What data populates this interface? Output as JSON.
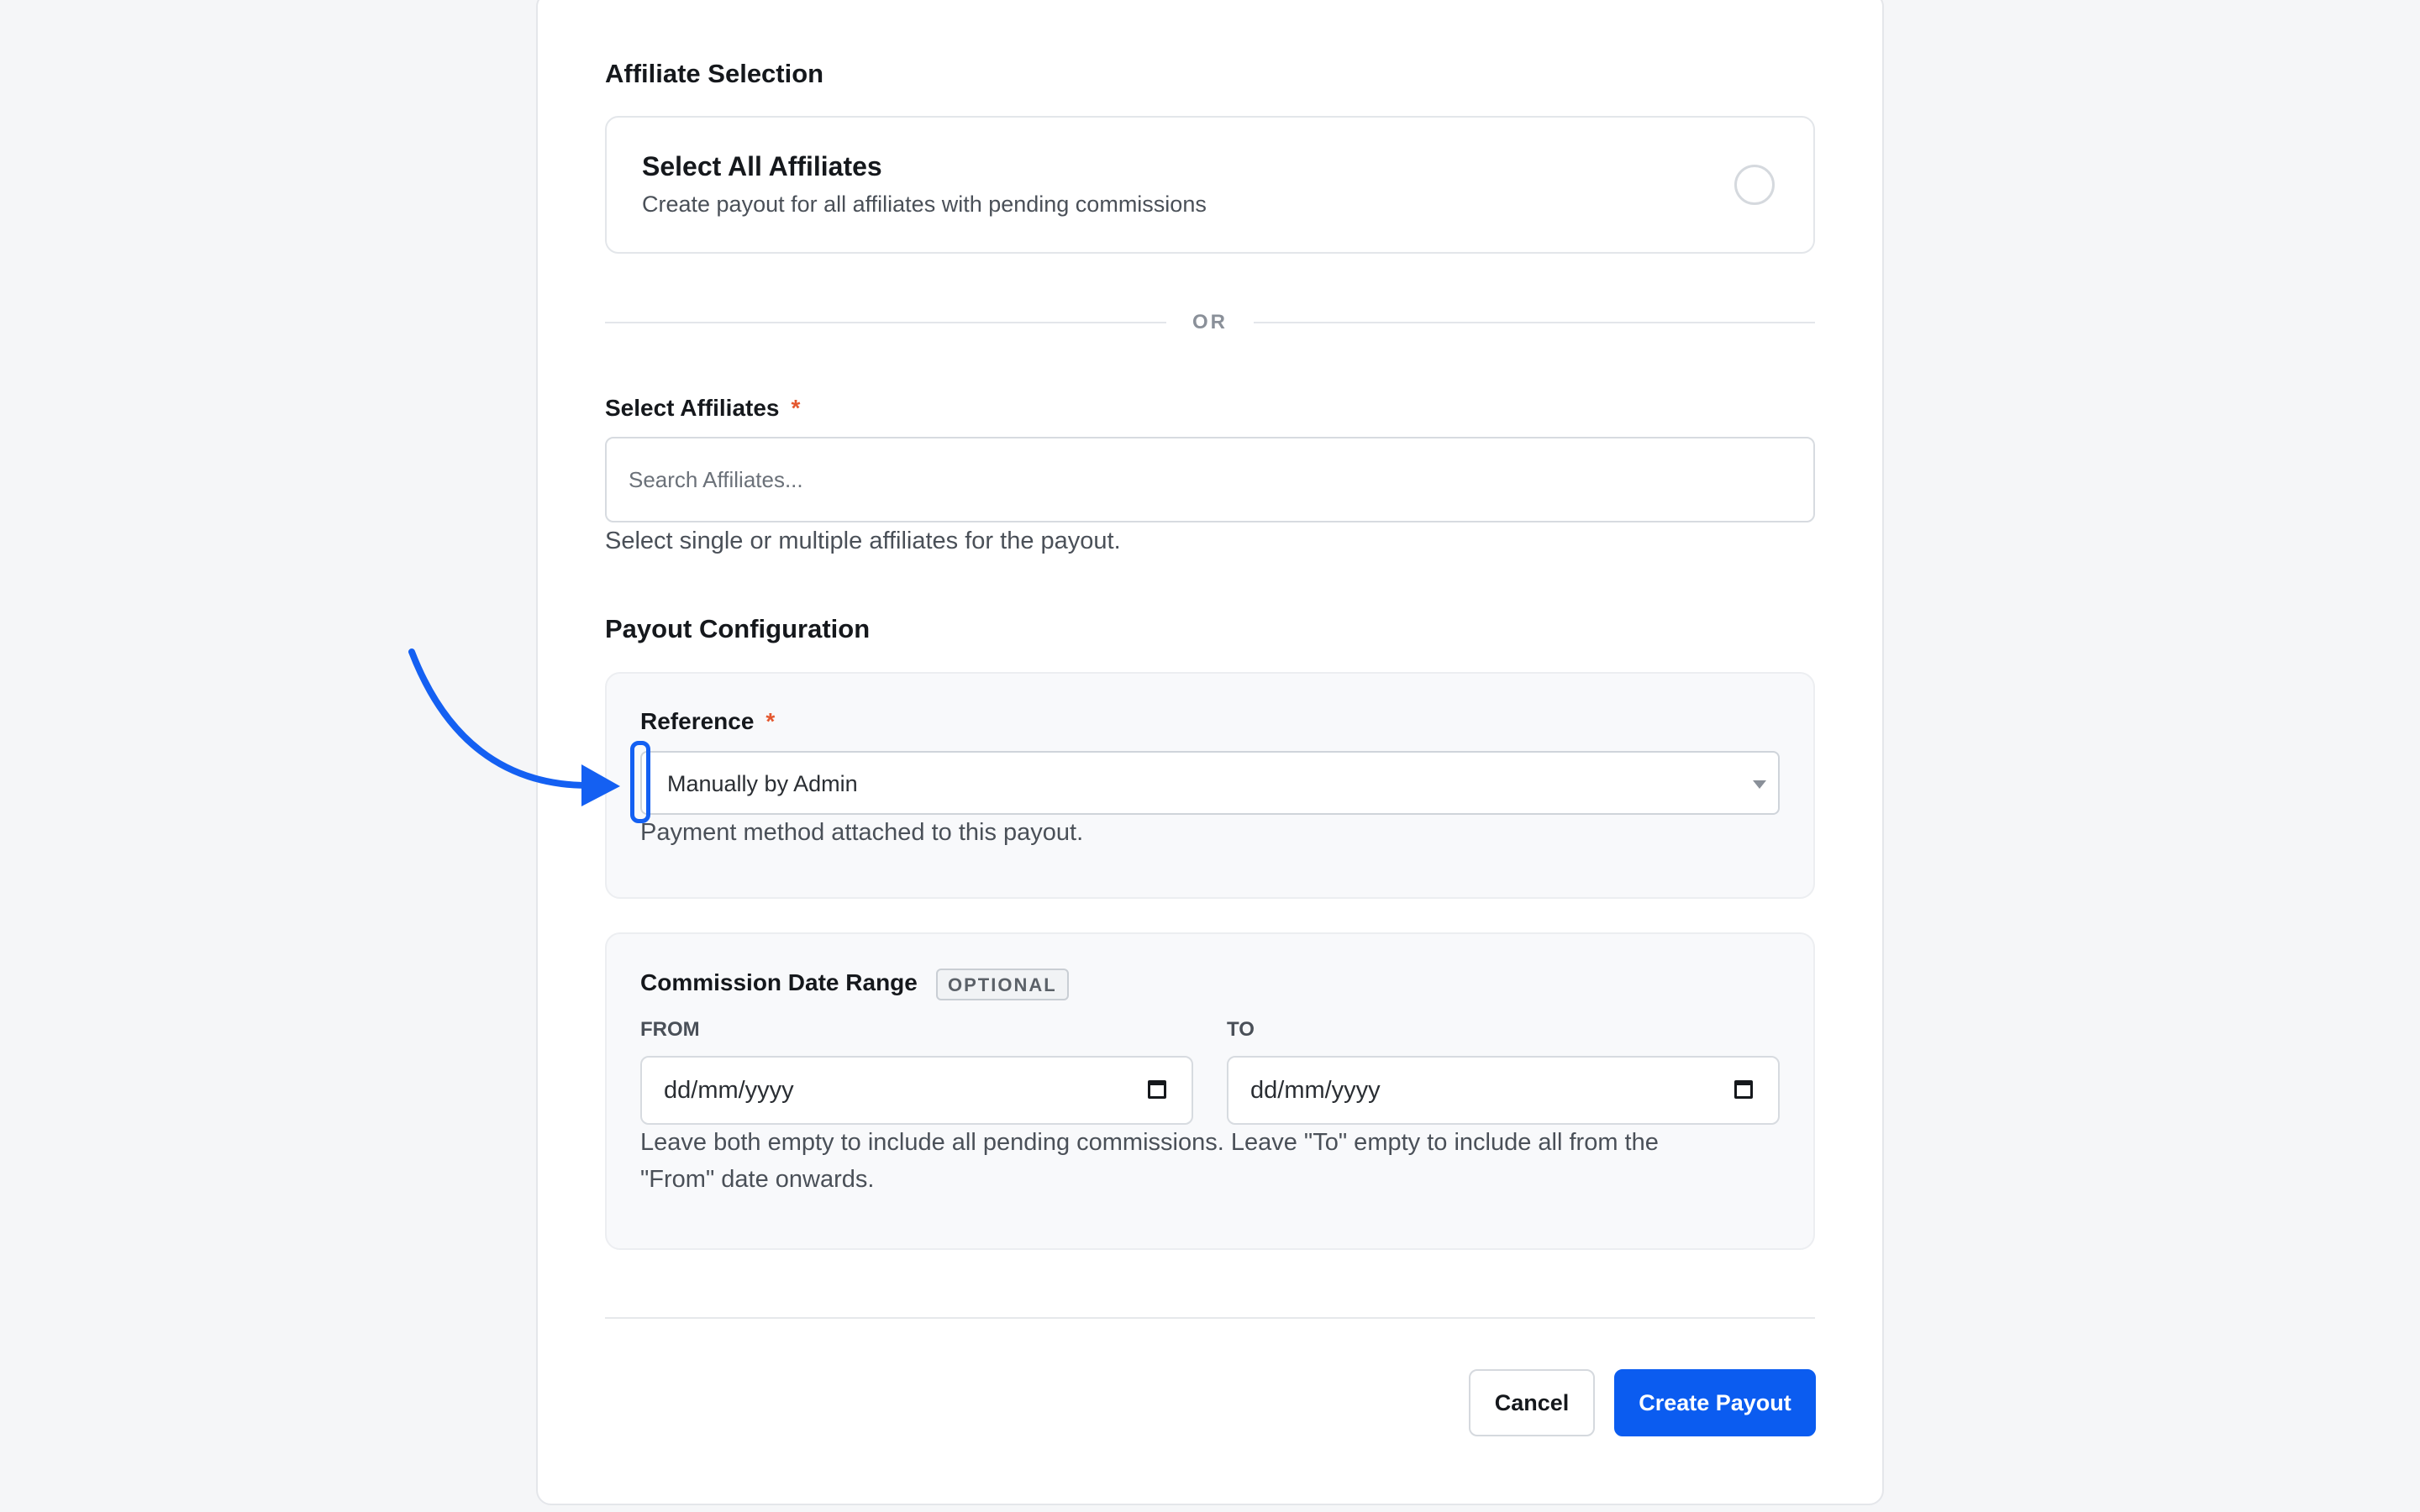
{
  "affiliate_selection": {
    "title": "Affiliate Selection",
    "select_all_title": "Select All Affiliates",
    "select_all_description": "Create payout for all affiliates with pending commissions",
    "or_label": "OR"
  },
  "select_affiliates": {
    "label": "Select Affiliates",
    "required_mark": "*",
    "placeholder": "Search Affiliates...",
    "help": "Select single or multiple affiliates for the payout."
  },
  "payout_configuration": {
    "title": "Payout Configuration",
    "reference_label": "Reference",
    "required_mark": "*",
    "reference_value": "Manually by Admin",
    "reference_help": "Payment method attached to this payout."
  },
  "date_range": {
    "title": "Commission Date Range",
    "badge": "OPTIONAL",
    "from_label": "FROM",
    "to_label": "TO",
    "from_value": "dd/mm/yyyy",
    "to_value": "dd/mm/yyyy",
    "help_line1": "Leave both empty to include all pending commissions. Leave \"To\" empty to include all from the",
    "help_line2": "\"From\" date onwards."
  },
  "actions": {
    "cancel_label": "Cancel",
    "create_label": "Create Payout"
  },
  "colors": {
    "accent": "#0b5cf0",
    "annotation": "#1460f2",
    "required": "#e4572e"
  }
}
